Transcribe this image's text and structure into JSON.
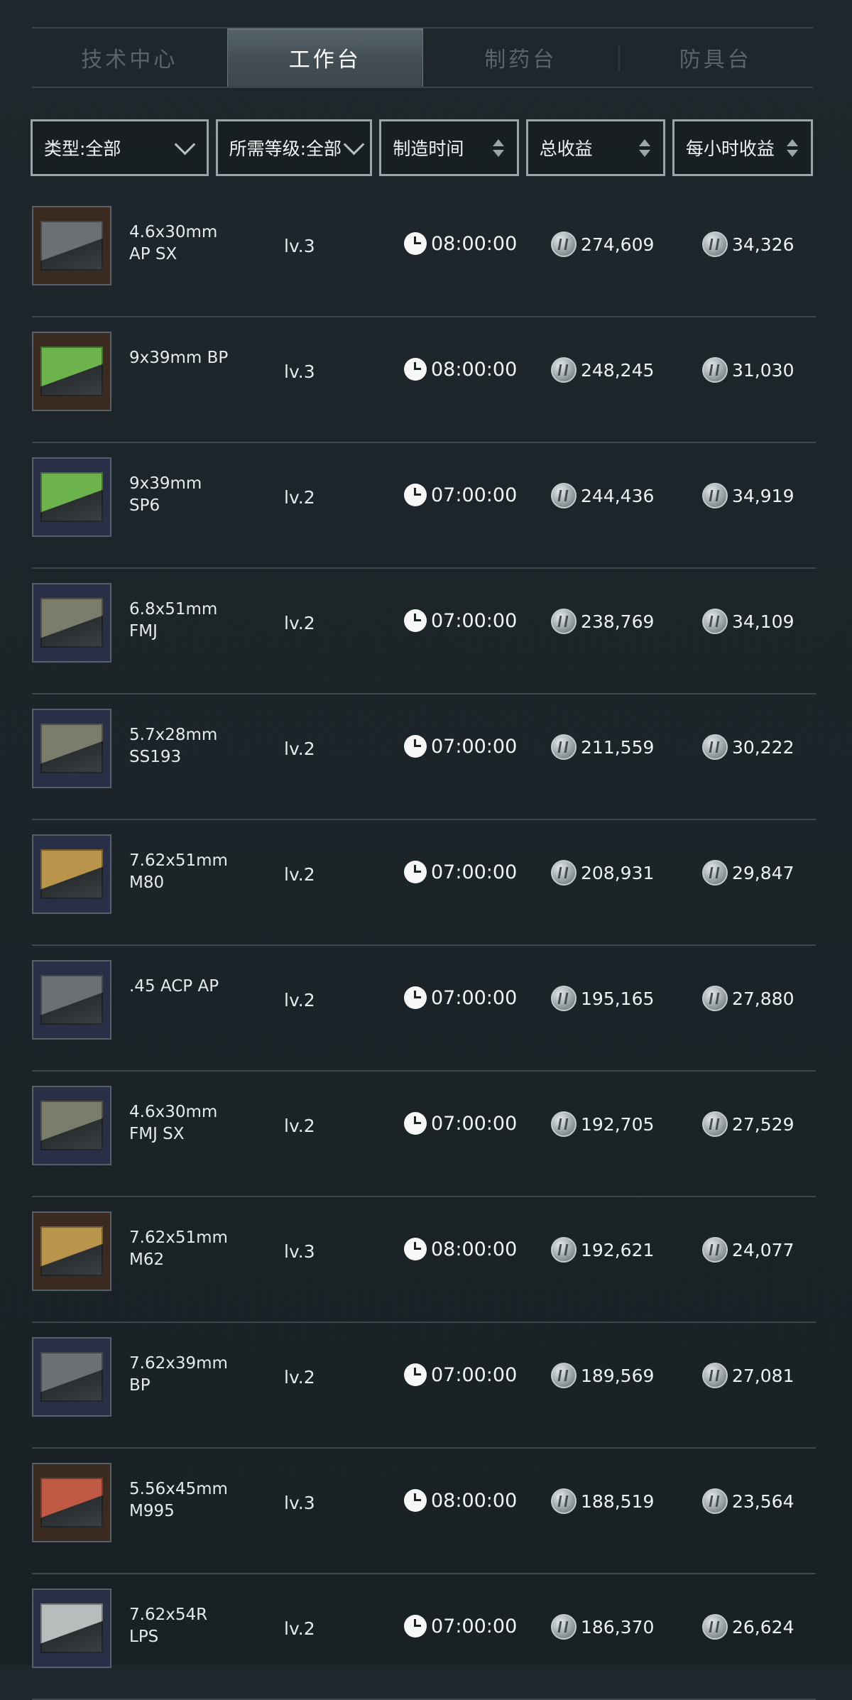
{
  "tabs": [
    {
      "label": "技术中心",
      "active": false
    },
    {
      "label": "工作台",
      "active": true
    },
    {
      "label": "制药台",
      "active": false
    },
    {
      "label": "防具台",
      "active": false
    }
  ],
  "filters": {
    "type_label": "类型:全部",
    "level_label": "所需等级:全部",
    "time_label": "制造时间",
    "total_label": "总收益",
    "hourly_label": "每小时收益"
  },
  "items": [
    {
      "name": "4.6x30mm AP SX",
      "level": "lv.3",
      "time": "08:00:00",
      "total": "274,609",
      "hourly": "34,326",
      "box_color": "#6a7073",
      "bg_color": "#3a2a20"
    },
    {
      "name": "9x39mm BP",
      "level": "lv.3",
      "time": "08:00:00",
      "total": "248,245",
      "hourly": "31,030",
      "box_color": "#6bb34a",
      "bg_color": "#3a2a20"
    },
    {
      "name": "9x39mm SP6",
      "level": "lv.2",
      "time": "07:00:00",
      "total": "244,436",
      "hourly": "34,919",
      "box_color": "#6bb34a",
      "bg_color": "#2a2f48"
    },
    {
      "name": "6.8x51mm FMJ",
      "level": "lv.2",
      "time": "07:00:00",
      "total": "238,769",
      "hourly": "34,109",
      "box_color": "#7a7c6c",
      "bg_color": "#2a2f48"
    },
    {
      "name": "5.7x28mm SS193",
      "level": "lv.2",
      "time": "07:00:00",
      "total": "211,559",
      "hourly": "30,222",
      "box_color": "#7a7c6c",
      "bg_color": "#2a2f48"
    },
    {
      "name": "7.62x51mm M80",
      "level": "lv.2",
      "time": "07:00:00",
      "total": "208,931",
      "hourly": "29,847",
      "box_color": "#b8954a",
      "bg_color": "#2a2f48"
    },
    {
      "name": ".45 ACP AP",
      "level": "lv.2",
      "time": "07:00:00",
      "total": "195,165",
      "hourly": "27,880",
      "box_color": "#6a7073",
      "bg_color": "#2a2f48"
    },
    {
      "name": "4.6x30mm FMJ SX",
      "level": "lv.2",
      "time": "07:00:00",
      "total": "192,705",
      "hourly": "27,529",
      "box_color": "#7a7c6c",
      "bg_color": "#2a2f48"
    },
    {
      "name": "7.62x51mm M62",
      "level": "lv.3",
      "time": "08:00:00",
      "total": "192,621",
      "hourly": "24,077",
      "box_color": "#b8954a",
      "bg_color": "#3a2a20"
    },
    {
      "name": "7.62x39mm BP",
      "level": "lv.2",
      "time": "07:00:00",
      "total": "189,569",
      "hourly": "27,081",
      "box_color": "#6a7073",
      "bg_color": "#2a2f48"
    },
    {
      "name": "5.56x45mm M995",
      "level": "lv.3",
      "time": "08:00:00",
      "total": "188,519",
      "hourly": "23,564",
      "box_color": "#c05a44",
      "bg_color": "#3a2a20"
    },
    {
      "name": "7.62x54R LPS",
      "level": "lv.2",
      "time": "07:00:00",
      "total": "186,370",
      "hourly": "26,624",
      "box_color": "#b9bcbc",
      "bg_color": "#2a2f48"
    }
  ]
}
